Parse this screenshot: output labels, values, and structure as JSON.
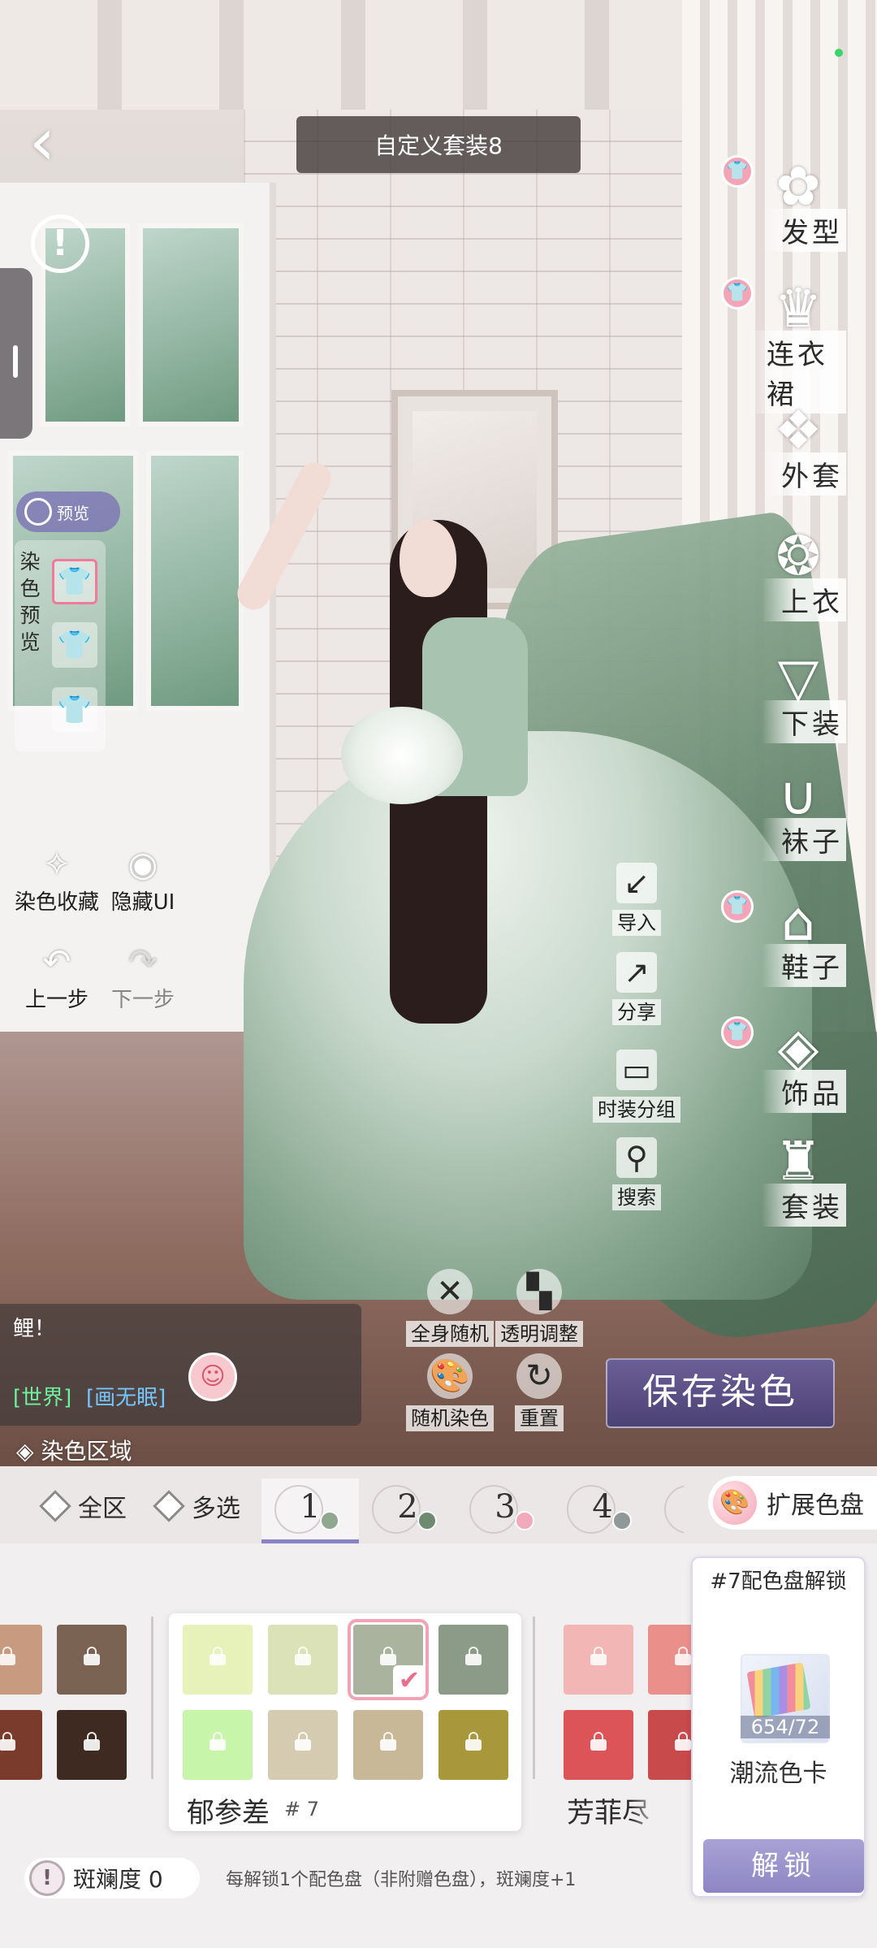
{
  "header": {
    "title": "自定义套装8"
  },
  "dye_preview": {
    "pill_label": "预览",
    "panel_label": "染色预览"
  },
  "left_tools": {
    "favorites": "染色收藏",
    "hide_ui": "隐藏UI",
    "undo": "上一步",
    "redo": "下一步"
  },
  "categories": [
    {
      "label": "发型",
      "icon": "hair-icon",
      "dyed": true
    },
    {
      "label": "连衣裙",
      "icon": "dress-icon",
      "dyed": true
    },
    {
      "label": "外套",
      "icon": "coat-icon",
      "dyed": false
    },
    {
      "label": "上衣",
      "icon": "top-icon",
      "dyed": false
    },
    {
      "label": "下装",
      "icon": "skirt-icon",
      "dyed": false
    },
    {
      "label": "袜子",
      "icon": "socks-icon",
      "dyed": false
    },
    {
      "label": "鞋子",
      "icon": "shoe-icon",
      "dyed": true
    },
    {
      "label": "饰品",
      "icon": "accessory-icon",
      "dyed": true
    },
    {
      "label": "套装",
      "icon": "outfit-icon",
      "dyed": false
    }
  ],
  "actions": {
    "import": "导入",
    "share": "分享",
    "group": "时装分组",
    "search": "搜索"
  },
  "scene_controls": {
    "random_all": "全身随机",
    "transparency": "透明调整",
    "random_dye": "随机染色",
    "reset": "重置"
  },
  "save_button": "保存染色",
  "chat": {
    "message": "鲤！",
    "channel": "[世界]",
    "user": "[画无眠]"
  },
  "dye_zone_label": "染色区域",
  "region": {
    "all": "全区",
    "multi": "多选",
    "tabs": [
      {
        "num": "1",
        "color": "#8fa88f",
        "active": true
      },
      {
        "num": "2",
        "color": "#6e8a70",
        "active": false
      },
      {
        "num": "3",
        "color": "#f2a9bb",
        "active": false
      },
      {
        "num": "4",
        "color": "#8f9a98",
        "active": false
      }
    ],
    "expand_palette": "扩展色盘"
  },
  "palette": {
    "left_colors": [
      "#c89b80",
      "#7b6354",
      "#7a3a2c",
      "#3f2a22"
    ],
    "group_colors": [
      "#e6f2b9",
      "#dce2b8",
      "#a9b39d",
      "#8c9a88",
      "#c7f5a9",
      "#d5cbb0",
      "#c8b898",
      "#a8983b"
    ],
    "selected_index": 2,
    "group_name": "郁参差",
    "group_number": "# 7",
    "right_colors": [
      "#f2b6b4",
      "#eb8f8a",
      "#dc5358",
      "#c94a4b"
    ],
    "next_group_name": "芳菲尽"
  },
  "unlock": {
    "title": "#7配色盘解锁",
    "count": "654/72",
    "card_name": "潮流色卡",
    "button": "解锁"
  },
  "footer": {
    "pill_label": "斑斓度 0",
    "note": "每解锁1个配色盘（非附赠色盘），斑斓度+1"
  }
}
